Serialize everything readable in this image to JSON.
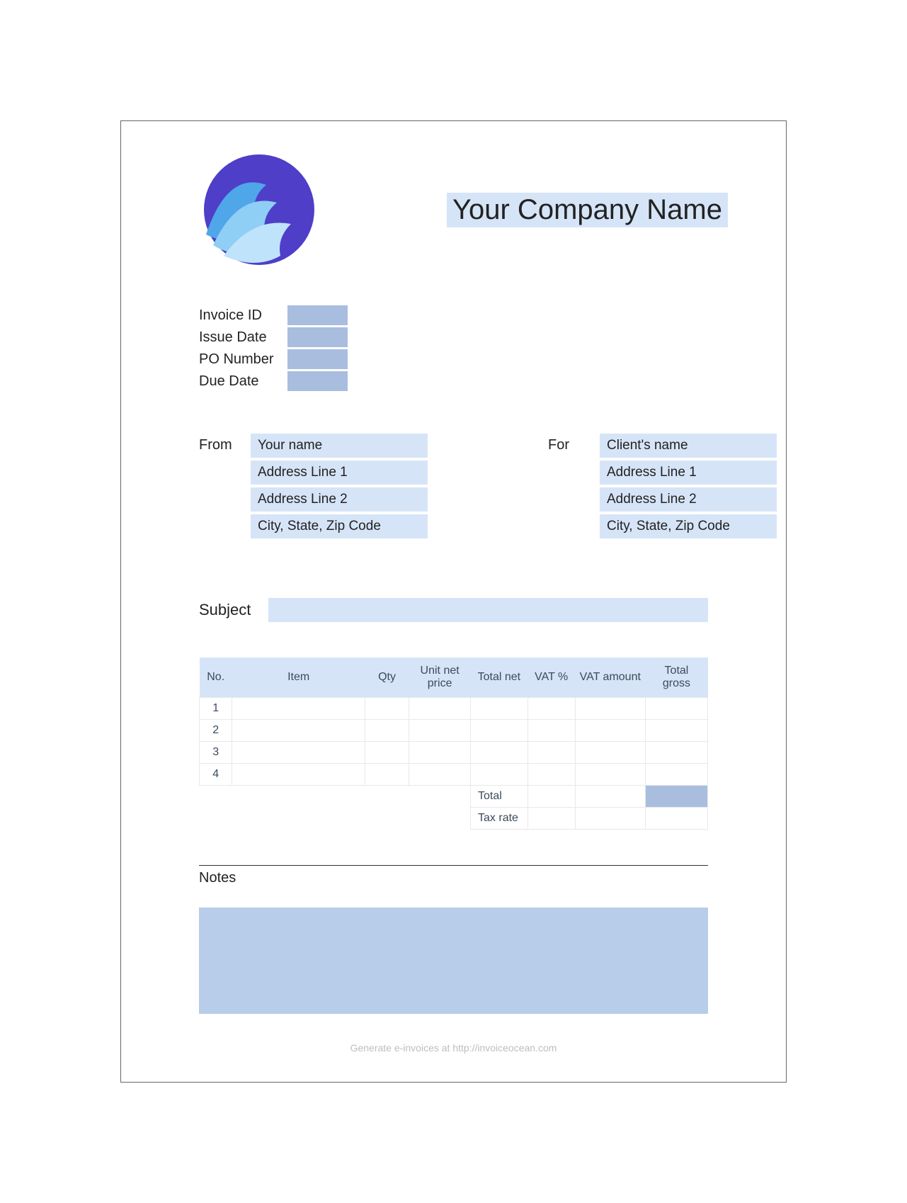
{
  "header": {
    "company_name": "Your Company Name"
  },
  "meta": {
    "invoice_id_label": "Invoice ID",
    "invoice_id": "",
    "issue_date_label": "Issue Date",
    "issue_date": "",
    "po_number_label": "PO Number",
    "po_number": "",
    "due_date_label": "Due Date",
    "due_date": ""
  },
  "from": {
    "label": "From",
    "lines": [
      "Your name",
      "Address Line 1",
      "Address Line 2",
      "City, State, Zip Code"
    ]
  },
  "for": {
    "label": "For",
    "lines": [
      "Client's name",
      "Address Line 1",
      "Address Line 2",
      "City, State, Zip Code"
    ]
  },
  "subject": {
    "label": "Subject",
    "value": ""
  },
  "table": {
    "headers": {
      "no": "No.",
      "item": "Item",
      "qty": "Qty",
      "unit": "Unit net price",
      "total_net": "Total net",
      "vat_pct": "VAT %",
      "vat_amt": "VAT amount",
      "total_gross": "Total gross"
    },
    "rows": [
      {
        "no": "1",
        "item": "",
        "qty": "",
        "unit": "",
        "total_net": "",
        "vat_pct": "",
        "vat_amt": "",
        "total_gross": ""
      },
      {
        "no": "2",
        "item": "",
        "qty": "",
        "unit": "",
        "total_net": "",
        "vat_pct": "",
        "vat_amt": "",
        "total_gross": ""
      },
      {
        "no": "3",
        "item": "",
        "qty": "",
        "unit": "",
        "total_net": "",
        "vat_pct": "",
        "vat_amt": "",
        "total_gross": ""
      },
      {
        "no": "4",
        "item": "",
        "qty": "",
        "unit": "",
        "total_net": "",
        "vat_pct": "",
        "vat_amt": "",
        "total_gross": ""
      }
    ],
    "totals": {
      "total_label": "Total",
      "total_vat_pct": "",
      "total_vat_amt": "",
      "total_gross": "",
      "tax_rate_label": "Tax rate",
      "tax_vat_pct": "",
      "tax_vat_amt": "",
      "tax_gross": ""
    }
  },
  "notes": {
    "label": "Notes",
    "value": ""
  },
  "footer": {
    "text": "Generate e-invoices at http://invoiceocean.com"
  }
}
